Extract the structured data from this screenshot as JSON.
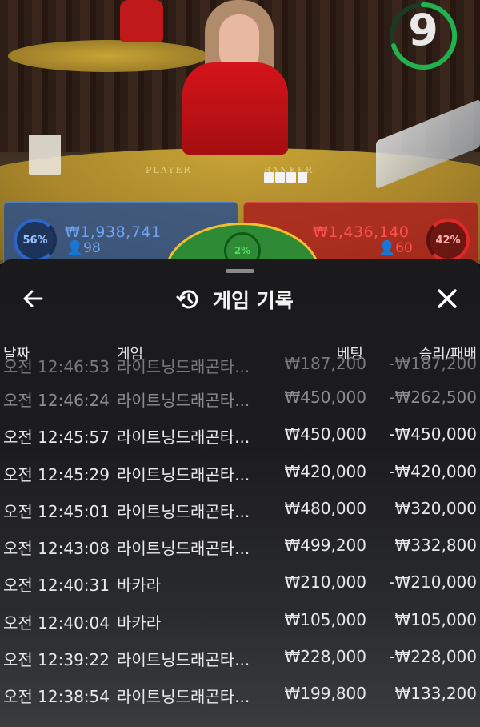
{
  "video": {
    "countdown": "9",
    "table_label_player": "PLAYER",
    "table_label_banker": "BANKER",
    "player": {
      "percent": "56%",
      "amount": "₩1,938,741",
      "count": "98"
    },
    "banker": {
      "percent": "42%",
      "amount": "₩1,436,140",
      "count": "60"
    },
    "tie": {
      "percent": "2%"
    },
    "colors": {
      "player": "#2b66c8",
      "banker": "#e02828",
      "tie": "#2f8a36",
      "timer": "#22b14c"
    }
  },
  "history": {
    "title": "게임 기록",
    "columns": {
      "date": "날짜",
      "game": "게임",
      "bet": "베팅",
      "win_loss": "승리/패배"
    },
    "partial_row": {
      "date": "오전 12:46:53",
      "game": "라이트닝드래곤타...",
      "bet": "₩187,200",
      "win_loss": "-₩187,200"
    },
    "rows": [
      {
        "date": "오전 12:46:24",
        "game": "라이트닝드래곤타...",
        "bet": "₩450,000",
        "win_loss": "-₩262,500"
      },
      {
        "date": "오전 12:45:57",
        "game": "라이트닝드래곤타...",
        "bet": "₩450,000",
        "win_loss": "-₩450,000"
      },
      {
        "date": "오전 12:45:29",
        "game": "라이트닝드래곤타...",
        "bet": "₩420,000",
        "win_loss": "-₩420,000"
      },
      {
        "date": "오전 12:45:01",
        "game": "라이트닝드래곤타...",
        "bet": "₩480,000",
        "win_loss": "₩320,000"
      },
      {
        "date": "오전 12:43:08",
        "game": "라이트닝드래곤타...",
        "bet": "₩499,200",
        "win_loss": "₩332,800"
      },
      {
        "date": "오전 12:40:31",
        "game": "바카라",
        "bet": "₩210,000",
        "win_loss": "-₩210,000"
      },
      {
        "date": "오전 12:40:04",
        "game": "바카라",
        "bet": "₩105,000",
        "win_loss": "₩105,000"
      },
      {
        "date": "오전 12:39:22",
        "game": "라이트닝드래곤타...",
        "bet": "₩228,000",
        "win_loss": "-₩228,000"
      },
      {
        "date": "오전 12:38:54",
        "game": "라이트닝드래곤타...",
        "bet": "₩199,800",
        "win_loss": "₩133,200"
      }
    ],
    "icons": {
      "back": "arrow-left-icon",
      "title": "history-icon",
      "close": "close-icon"
    }
  }
}
